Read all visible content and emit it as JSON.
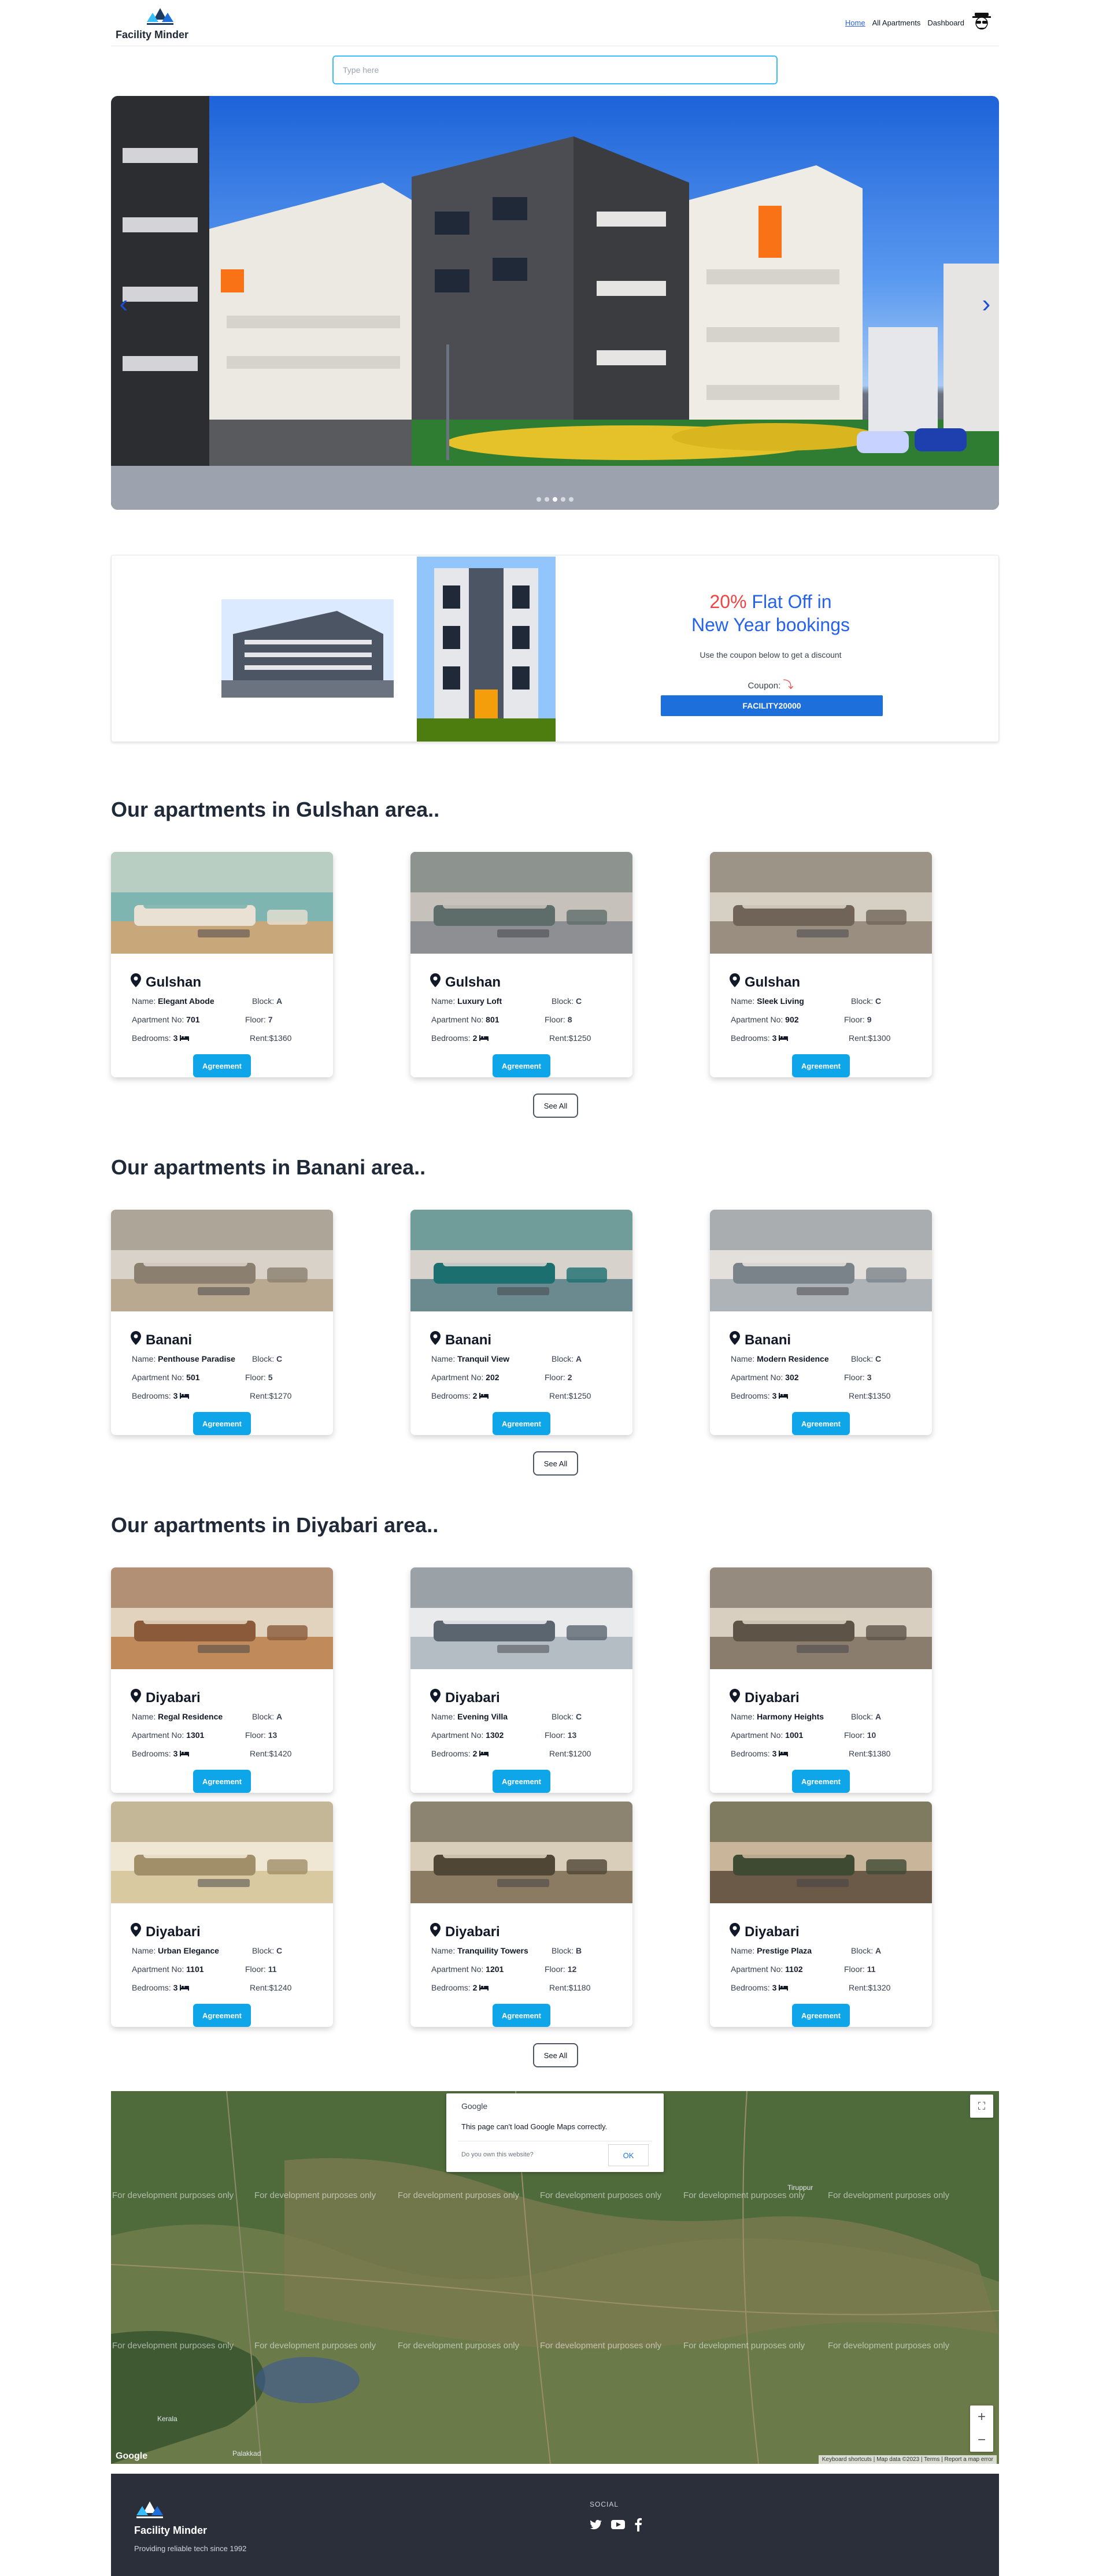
{
  "nav": {
    "brand": "Facility Minder",
    "links": [
      "Home",
      "All Apartments",
      "Dashboard"
    ]
  },
  "search": {
    "placeholder": "Type here"
  },
  "promo": {
    "percent": "20%",
    "title_rest": " Flat Off in",
    "title_line2": "New Year bookings",
    "subtitle": "Use the coupon below to get a discount",
    "coupon_label": "Coupon:",
    "coupon_code": "FACILITY20000"
  },
  "sections": [
    {
      "title": "Our apartments in Gulshan area..",
      "cards": [
        {
          "area": "Gulshan",
          "name": "Elegant Abode",
          "block": "A",
          "apt_no": "701",
          "floor": "7",
          "bedrooms": "3",
          "rent": "$1360",
          "button": "Agreement"
        },
        {
          "area": "Gulshan",
          "name": "Luxury Loft",
          "block": "C",
          "apt_no": "801",
          "floor": "8",
          "bedrooms": "2",
          "rent": "$1250",
          "button": "Agreement"
        },
        {
          "area": "Gulshan",
          "name": "Sleek Living",
          "block": "C",
          "apt_no": "902",
          "floor": "9",
          "bedrooms": "3",
          "rent": "$1300",
          "button": "Agreement"
        }
      ],
      "see_all": "See All"
    },
    {
      "title": "Our apartments in Banani area..",
      "cards": [
        {
          "area": "Banani",
          "name": "Penthouse Paradise",
          "block": "C",
          "apt_no": "501",
          "floor": "5",
          "bedrooms": "3",
          "rent": "$1270",
          "button": "Agreement"
        },
        {
          "area": "Banani",
          "name": "Tranquil View",
          "block": "A",
          "apt_no": "202",
          "floor": "2",
          "bedrooms": "2",
          "rent": "$1250",
          "button": "Agreement"
        },
        {
          "area": "Banani",
          "name": "Modern Residence",
          "block": "C",
          "apt_no": "302",
          "floor": "3",
          "bedrooms": "3",
          "rent": "$1350",
          "button": "Agreement"
        }
      ],
      "see_all": "See All"
    },
    {
      "title": "Our apartments in Diyabari area..",
      "cards": [
        {
          "area": "Diyabari",
          "name": "Regal Residence",
          "block": "A",
          "apt_no": "1301",
          "floor": "13",
          "bedrooms": "3",
          "rent": "$1420",
          "button": "Agreement"
        },
        {
          "area": "Diyabari",
          "name": "Evening Villa",
          "block": "C",
          "apt_no": "1302",
          "floor": "13",
          "bedrooms": "2",
          "rent": "$1200",
          "button": "Agreement"
        },
        {
          "area": "Diyabari",
          "name": "Harmony Heights",
          "block": "A",
          "apt_no": "1001",
          "floor": "10",
          "bedrooms": "3",
          "rent": "$1380",
          "button": "Agreement"
        },
        {
          "area": "Diyabari",
          "name": "Urban Elegance",
          "block": "C",
          "apt_no": "1101",
          "floor": "11",
          "bedrooms": "3",
          "rent": "$1240",
          "button": "Agreement"
        },
        {
          "area": "Diyabari",
          "name": "Tranquility Towers",
          "block": "B",
          "apt_no": "1201",
          "floor": "12",
          "bedrooms": "2",
          "rent": "$1180",
          "button": "Agreement"
        },
        {
          "area": "Diyabari",
          "name": "Prestige Plaza",
          "block": "A",
          "apt_no": "1102",
          "floor": "11",
          "bedrooms": "3",
          "rent": "$1320",
          "button": "Agreement"
        }
      ],
      "see_all": "See All"
    }
  ],
  "labels": {
    "name": "Name:",
    "block": "Block:",
    "apt_no": "Apartment No:",
    "floor": "Floor:",
    "bedrooms": "Bedrooms:",
    "rent": "Rent:"
  },
  "map": {
    "dialog_title": "Google",
    "dialog_message": "This page can't load Google Maps correctly.",
    "dialog_question": "Do you own this website?",
    "dialog_ok": "OK",
    "watermark": "For development purposes only",
    "google_logo": "Google",
    "footer_text": "Keyboard shortcuts  |  Map data ©2023  |  Terms  |  Report a map error",
    "places": [
      "Palakkad",
      "Kerala",
      "Tiruppur"
    ]
  },
  "footer": {
    "brand": "Facility Minder",
    "tagline": "Providing reliable tech since 1992",
    "social_title": "SOCIAL"
  },
  "colors": {
    "accent": "#0ea5e9",
    "promo_blue": "#2563eb",
    "promo_red": "#ef4444",
    "footer_bg": "#2b2f3a"
  }
}
